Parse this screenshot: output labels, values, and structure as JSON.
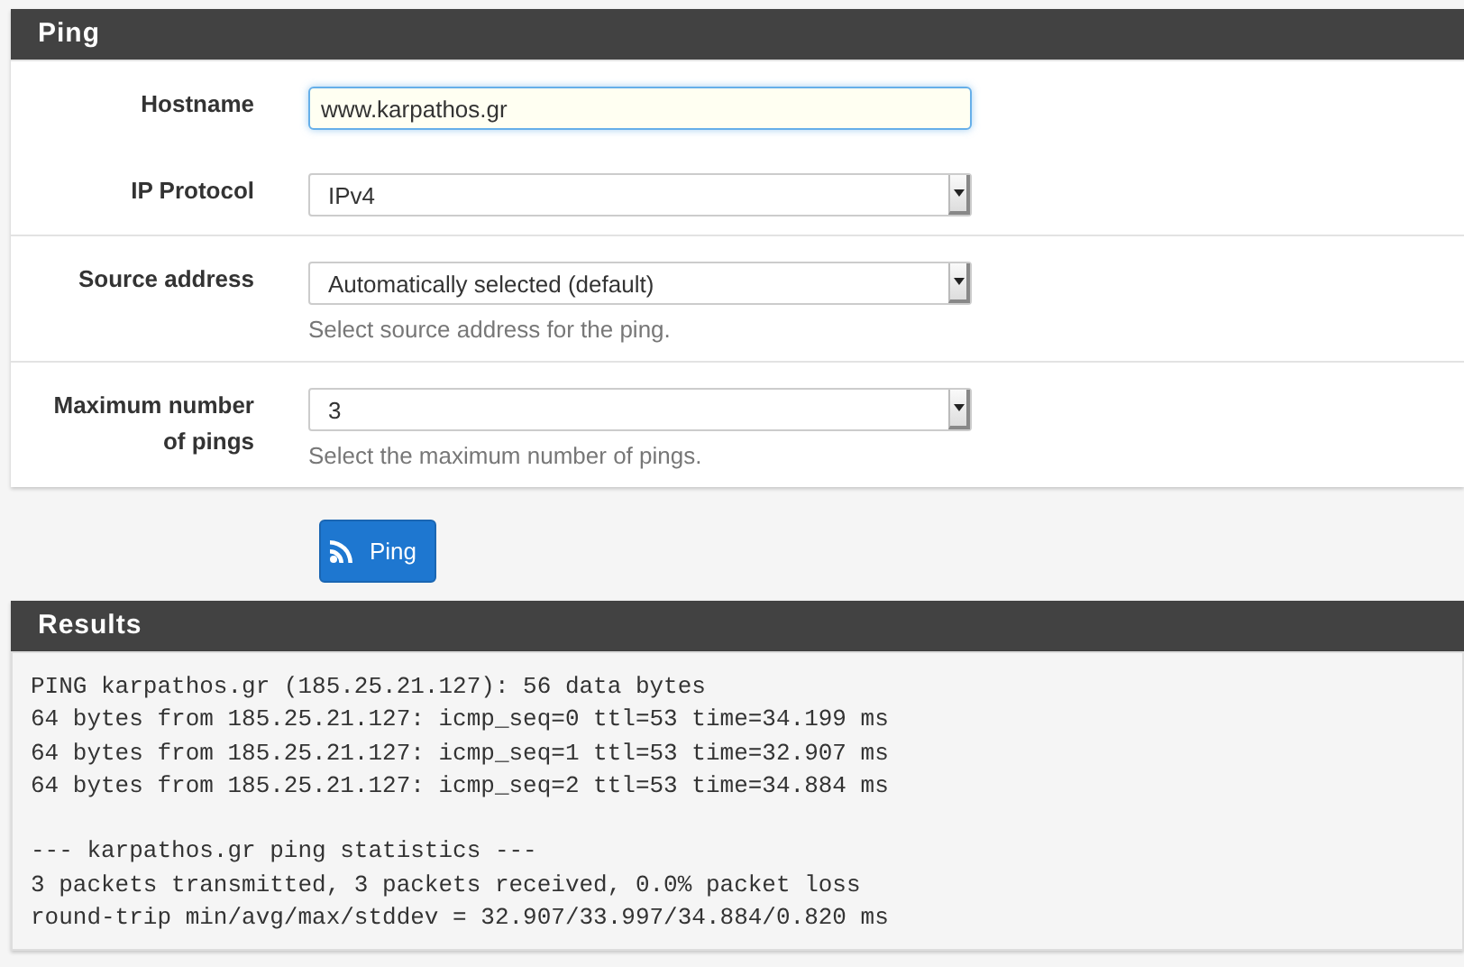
{
  "ping_panel": {
    "title": "Ping",
    "fields": [
      {
        "label": "Hostname",
        "kind": "text",
        "value": "www.karpathos.gr",
        "focused": true
      },
      {
        "label": "IP Protocol",
        "kind": "select",
        "value": "IPv4"
      },
      {
        "label": "Source address",
        "kind": "select",
        "value": "Automatically selected (default)",
        "help": "Select source address for the ping."
      },
      {
        "label": "Maximum number of pings",
        "kind": "select",
        "value": "3",
        "help": "Select the maximum number of pings."
      }
    ]
  },
  "ping_button": "Ping",
  "results_panel": {
    "title": "Results",
    "output": "PING karpathos.gr (185.25.21.127): 56 data bytes\n64 bytes from 185.25.21.127: icmp_seq=0 ttl=53 time=34.199 ms\n64 bytes from 185.25.21.127: icmp_seq=1 ttl=53 time=32.907 ms\n64 bytes from 185.25.21.127: icmp_seq=2 ttl=53 time=34.884 ms\n\n--- karpathos.gr ping statistics ---\n3 packets transmitted, 3 packets received, 0.0% packet loss\nround-trip min/avg/max/stddev = 32.907/33.997/34.884/0.820 ms"
  }
}
